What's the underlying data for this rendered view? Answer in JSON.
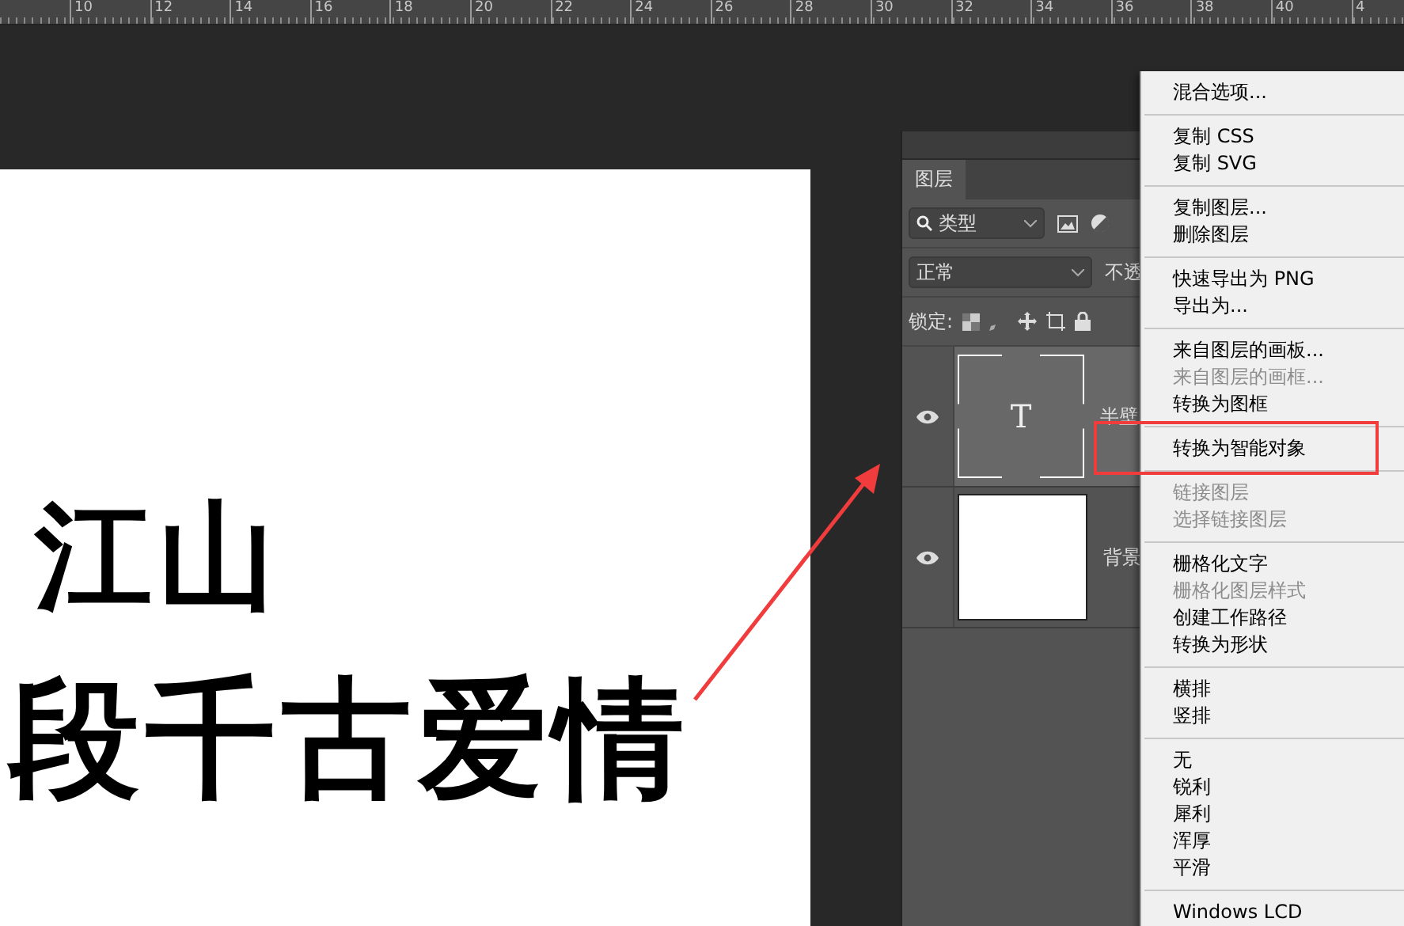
{
  "ruler": {
    "labels": [
      "10",
      "12",
      "14",
      "16",
      "18",
      "20",
      "22",
      "24",
      "26",
      "28",
      "30",
      "32",
      "34",
      "36",
      "38",
      "40",
      "4"
    ]
  },
  "document": {
    "lines": [
      "江山",
      "段千古爱情"
    ]
  },
  "layers_panel": {
    "tab": {
      "label": "图层",
      "selected": true
    },
    "filter": {
      "value": "类型"
    },
    "blend_mode": {
      "value": "正常"
    },
    "opacity_label": "不透",
    "lock_label": "锁定:",
    "layers": [
      {
        "name": "半壁",
        "kind": "text",
        "thumb": "T",
        "visible": true,
        "selected": true
      },
      {
        "name": "背景",
        "kind": "fill",
        "visible": true,
        "selected": false
      }
    ]
  },
  "context_menu": {
    "groups": [
      [
        {
          "label": "混合选项...",
          "disabled": false,
          "highlighted": false
        }
      ],
      [
        {
          "label": "复制 CSS",
          "disabled": false,
          "highlighted": false
        },
        {
          "label": "复制 SVG",
          "disabled": false,
          "highlighted": false
        }
      ],
      [
        {
          "label": "复制图层...",
          "disabled": false,
          "highlighted": false
        },
        {
          "label": "删除图层",
          "disabled": false,
          "highlighted": false
        }
      ],
      [
        {
          "label": "快速导出为 PNG",
          "disabled": false,
          "highlighted": false
        },
        {
          "label": "导出为...",
          "disabled": false,
          "highlighted": false
        }
      ],
      [
        {
          "label": "来自图层的画板...",
          "disabled": false,
          "highlighted": false
        },
        {
          "label": "来自图层的画框...",
          "disabled": true,
          "highlighted": false
        },
        {
          "label": "转换为图框",
          "disabled": false,
          "highlighted": false
        }
      ],
      [
        {
          "label": "转换为智能对象",
          "disabled": false,
          "highlighted": true
        }
      ],
      [
        {
          "label": "链接图层",
          "disabled": true,
          "highlighted": false
        },
        {
          "label": "选择链接图层",
          "disabled": true,
          "highlighted": false
        }
      ],
      [
        {
          "label": "栅格化文字",
          "disabled": false,
          "highlighted": false
        },
        {
          "label": "栅格化图层样式",
          "disabled": true,
          "highlighted": false
        },
        {
          "label": "创建工作路径",
          "disabled": false,
          "highlighted": false
        },
        {
          "label": "转换为形状",
          "disabled": false,
          "highlighted": false
        }
      ],
      [
        {
          "label": "横排",
          "disabled": false,
          "highlighted": false
        },
        {
          "label": "竖排",
          "disabled": false,
          "highlighted": false
        }
      ],
      [
        {
          "label": "无",
          "disabled": false,
          "highlighted": false
        },
        {
          "label": "锐利",
          "disabled": false,
          "highlighted": false
        },
        {
          "label": "犀利",
          "disabled": false,
          "highlighted": false
        },
        {
          "label": "浑厚",
          "disabled": false,
          "highlighted": false
        },
        {
          "label": "平滑",
          "disabled": false,
          "highlighted": false
        }
      ],
      [
        {
          "label": "Windows LCD",
          "disabled": false,
          "highlighted": false
        }
      ]
    ]
  }
}
